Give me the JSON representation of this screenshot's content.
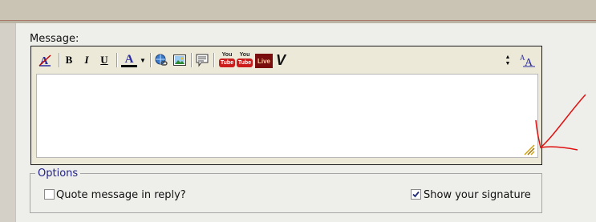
{
  "message_label": "Message:",
  "toolbar": {
    "bold": "B",
    "italic": "I",
    "underline": "U",
    "font_color": "A",
    "youtube_you": "You",
    "youtube_tube": "Tube",
    "liveleak": "Live",
    "vimeo": "V",
    "text_size_small": "A",
    "text_size_large": "A"
  },
  "editor": {
    "content": ""
  },
  "options": {
    "legend": "Options",
    "quote_label": "Quote message in reply?",
    "quote_checked": false,
    "signature_label": "Show your signature",
    "signature_checked": true
  },
  "annotation": {
    "color": "#e01010"
  }
}
